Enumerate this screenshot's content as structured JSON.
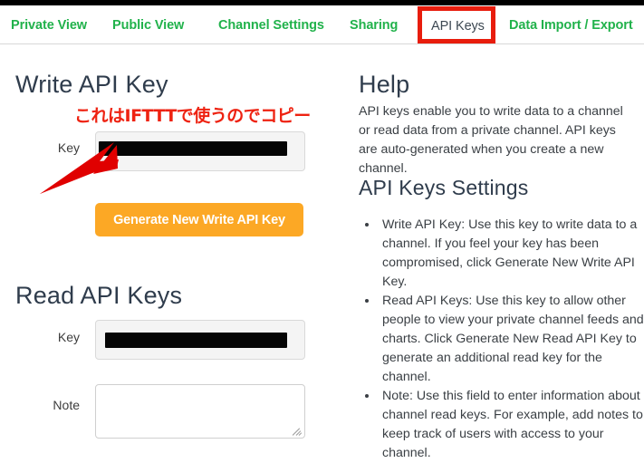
{
  "tabs": [
    {
      "id": "private",
      "label": "Private View",
      "active": false
    },
    {
      "id": "public",
      "label": "Public View",
      "active": false
    },
    {
      "id": "channel",
      "label": "Channel Settings",
      "active": false
    },
    {
      "id": "sharing",
      "label": "Sharing",
      "active": false
    },
    {
      "id": "apikeys",
      "label": "API Keys",
      "active": true
    },
    {
      "id": "dataio",
      "label": "Data Import / Export",
      "active": false
    }
  ],
  "write_section": {
    "heading": "Write API Key",
    "key_label": "Key",
    "key_value": "",
    "key_redacted": true,
    "generate_button_label": "Generate New Write API Key"
  },
  "read_section": {
    "heading": "Read API Keys",
    "key_label": "Key",
    "key_value": "",
    "key_redacted": true,
    "note_label": "Note",
    "note_value": "",
    "note_placeholder": ""
  },
  "help": {
    "heading": "Help",
    "paragraph": "API keys enable you to write data to a channel or read data from a private channel. API keys are auto-generated when you create a new channel.",
    "settings_heading": "API Keys Settings",
    "items": [
      "Write API Key: Use this key to write data to a channel. If you feel your key has been compromised, click Generate New Write API Key.",
      "Read API Keys: Use this key to allow other people to view your private channel feeds and charts. Click Generate New Read API Key to generate an additional read key for the channel.",
      "Note: Use this field to enter information about channel read keys. For example, add notes to keep track of users with access to your channel."
    ]
  },
  "annotations": {
    "callout_text": "これはIFTTTで使うのでコピー",
    "callout_color": "#ee2211",
    "highlight_box_color": "#e81d0d",
    "arrow_color": "#e00000"
  },
  "colors": {
    "tab_green": "#21b24b",
    "tab_active_text": "#3d4852",
    "heading_slate": "#2f3c4c",
    "button_orange": "#fca825",
    "input_fill": "#f4f4f4",
    "input_border": "#d9d9d9",
    "body_text": "#3a3f44",
    "top_strip": "#000000"
  }
}
